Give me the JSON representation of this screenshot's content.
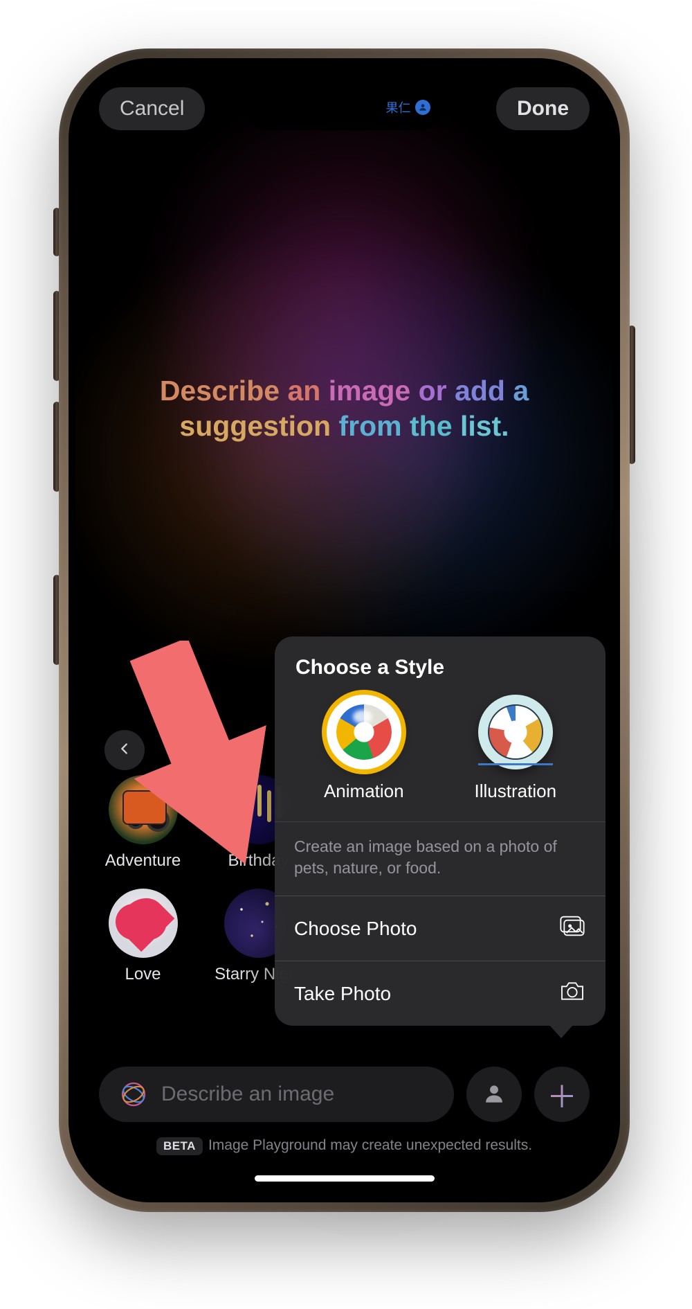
{
  "topbar": {
    "cancel": "Cancel",
    "done": "Done"
  },
  "island": {
    "label": "果仁"
  },
  "hero": {
    "words": [
      "Describe",
      "an",
      "image",
      "or",
      "add",
      "a",
      "suggestion",
      "from",
      "the",
      "list."
    ]
  },
  "suggestions": {
    "row1": [
      {
        "label": "Adventure",
        "style": "c-adventure"
      },
      {
        "label": "Birthday",
        "style": "c-birthday"
      }
    ],
    "row2": [
      {
        "label": "Love",
        "style": "c-love"
      },
      {
        "label": "Starry Night",
        "style": "c-starry"
      }
    ]
  },
  "popover": {
    "title": "Choose a Style",
    "styles": [
      {
        "key": "animation",
        "label": "Animation"
      },
      {
        "key": "illustration",
        "label": "Illustration"
      }
    ],
    "description": "Create an image based on a photo of pets, nature, or food.",
    "choose_photo": "Choose Photo",
    "take_photo": "Take Photo"
  },
  "input": {
    "placeholder": "Describe an image"
  },
  "footer": {
    "badge": "BETA",
    "text": "Image Playground may create unexpected results."
  }
}
